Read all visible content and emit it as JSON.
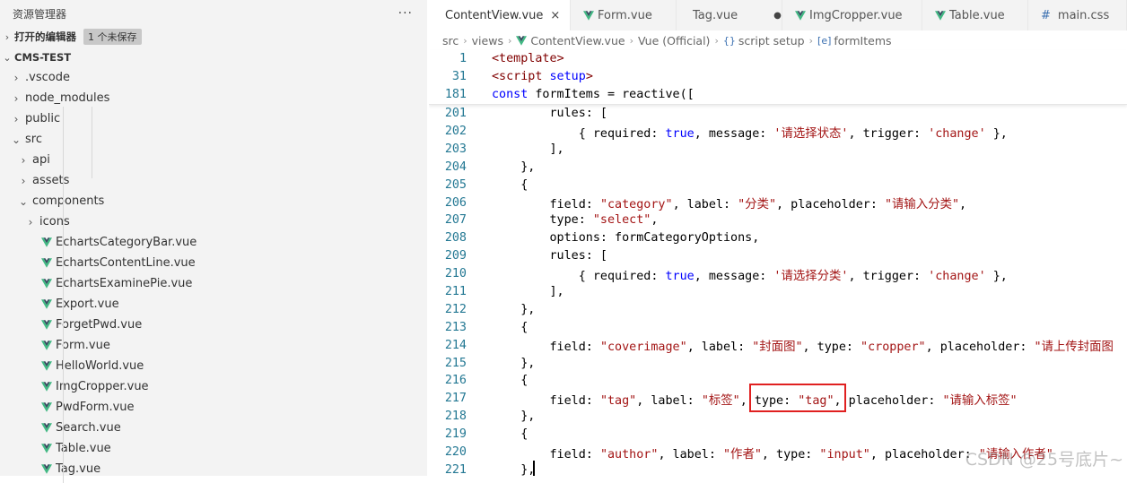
{
  "explorer": {
    "title": "资源管理器",
    "more": "···",
    "open_editors": {
      "label": "打开的编辑器",
      "badge": "1 个未保存"
    },
    "project": "CMS-TEST",
    "tree": [
      {
        "label": ".vscode",
        "kind": "folder",
        "depth": 0,
        "expanded": false
      },
      {
        "label": "node_modules",
        "kind": "folder",
        "depth": 0,
        "expanded": false
      },
      {
        "label": "public",
        "kind": "folder",
        "depth": 0,
        "expanded": false
      },
      {
        "label": "src",
        "kind": "folder",
        "depth": 0,
        "expanded": true
      },
      {
        "label": "api",
        "kind": "folder",
        "depth": 1,
        "expanded": false
      },
      {
        "label": "assets",
        "kind": "folder",
        "depth": 1,
        "expanded": false
      },
      {
        "label": "components",
        "kind": "folder",
        "depth": 1,
        "expanded": true
      },
      {
        "label": "icons",
        "kind": "folder",
        "depth": 2,
        "expanded": false
      },
      {
        "label": "EchartsCategoryBar.vue",
        "kind": "vue",
        "depth": 2
      },
      {
        "label": "EchartsContentLine.vue",
        "kind": "vue",
        "depth": 2
      },
      {
        "label": "EchartsExaminePie.vue",
        "kind": "vue",
        "depth": 2
      },
      {
        "label": "Export.vue",
        "kind": "vue",
        "depth": 2
      },
      {
        "label": "ForgetPwd.vue",
        "kind": "vue",
        "depth": 2
      },
      {
        "label": "Form.vue",
        "kind": "vue",
        "depth": 2
      },
      {
        "label": "HelloWorld.vue",
        "kind": "vue",
        "depth": 2
      },
      {
        "label": "ImgCropper.vue",
        "kind": "vue",
        "depth": 2
      },
      {
        "label": "PwdForm.vue",
        "kind": "vue",
        "depth": 2
      },
      {
        "label": "Search.vue",
        "kind": "vue",
        "depth": 2
      },
      {
        "label": "Table.vue",
        "kind": "vue",
        "depth": 2
      },
      {
        "label": "Tag.vue",
        "kind": "vue",
        "depth": 2
      }
    ]
  },
  "tabs": [
    {
      "label": "ContentView.vue",
      "icon": "vue-icon",
      "active": true,
      "close": "×"
    },
    {
      "label": "Form.vue",
      "icon": "vue-icon"
    },
    {
      "label": "Tag.vue",
      "icon": "vue-icon",
      "modified": "●"
    },
    {
      "label": "ImgCropper.vue",
      "icon": "vue-icon"
    },
    {
      "label": "Table.vue",
      "icon": "vue-icon"
    },
    {
      "label": "main.css",
      "icon": "css-hash-icon",
      "glyph": "#"
    }
  ],
  "breadcrumb": {
    "items": [
      "src",
      "views",
      "ContentView.vue",
      "Vue (Official)",
      "script setup",
      "formItems"
    ],
    "braces": "{}",
    "var_icon": "[e]"
  },
  "sticky_lines": [
    {
      "n": "1",
      "code": "<template>"
    },
    {
      "n": "31",
      "code": "<script setup>"
    },
    {
      "n": "181",
      "code": "const formItems = reactive(["
    }
  ],
  "code_lines": [
    {
      "n": "201",
      "code": "        rules: ["
    },
    {
      "n": "202",
      "code": "            { required: true, message: '请选择状态', trigger: 'change' },"
    },
    {
      "n": "203",
      "code": "        ],"
    },
    {
      "n": "204",
      "code": "    },"
    },
    {
      "n": "205",
      "code": "    {"
    },
    {
      "n": "206",
      "code": "        field: \"category\", label: \"分类\", placeholder: \"请输入分类\","
    },
    {
      "n": "207",
      "code": "        type: \"select\","
    },
    {
      "n": "208",
      "code": "        options: formCategoryOptions,"
    },
    {
      "n": "209",
      "code": "        rules: ["
    },
    {
      "n": "210",
      "code": "            { required: true, message: '请选择分类', trigger: 'change' },"
    },
    {
      "n": "211",
      "code": "        ],"
    },
    {
      "n": "212",
      "code": "    },"
    },
    {
      "n": "213",
      "code": "    {"
    },
    {
      "n": "214",
      "code": "        field: \"coverimage\", label: \"封面图\", type: \"cropper\", placeholder: \"请上传封面图"
    },
    {
      "n": "215",
      "code": "    },"
    },
    {
      "n": "216",
      "code": "    {"
    },
    {
      "n": "217",
      "code": "        field: \"tag\", label: \"标签\", type: \"tag\", placeholder: \"请输入标签\""
    },
    {
      "n": "218",
      "code": "    },"
    },
    {
      "n": "219",
      "code": "    {"
    },
    {
      "n": "220",
      "code": "        field: \"author\", label: \"作者\", type: \"input\", placeholder: \"请输入作者\""
    },
    {
      "n": "221",
      "code": "    },"
    }
  ],
  "highlight": {
    "text": "type: \"tag\",",
    "color": "#e02020"
  },
  "watermark": "CSDN @25号底片~",
  "colors": {
    "keyword": "#0000ff",
    "string": "#a31515",
    "tag": "#800000",
    "line_number": "#237893",
    "vue": "#41b883"
  }
}
